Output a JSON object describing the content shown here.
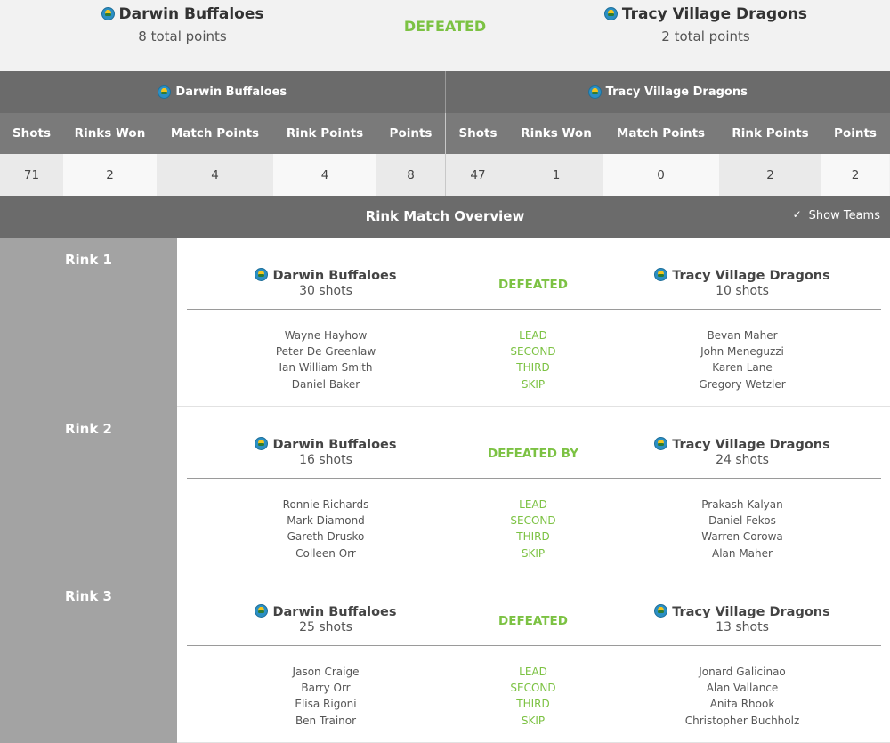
{
  "header": {
    "home_team": "Darwin Buffaloes",
    "home_points": "8 total points",
    "result": "DEFEATED",
    "away_team": "Tracy Village Dragons",
    "away_points": "2 total points"
  },
  "summary": {
    "home_team": "Darwin Buffaloes",
    "away_team": "Tracy Village Dragons",
    "columns": [
      "Shots",
      "Rinks Won",
      "Match Points",
      "Rink Points",
      "Points"
    ],
    "home_values": [
      "71",
      "2",
      "4",
      "4",
      "8"
    ],
    "away_values": [
      "47",
      "1",
      "0",
      "2",
      "2"
    ]
  },
  "overview": {
    "title": "Rink Match Overview",
    "show_teams_label": "Show Teams",
    "show_teams_checked": true
  },
  "positions": [
    "LEAD",
    "SECOND",
    "THIRD",
    "SKIP"
  ],
  "rinks": [
    {
      "label": "Rink 1",
      "home_team": "Darwin Buffaloes",
      "home_shots": "30 shots",
      "result": "DEFEATED",
      "away_team": "Tracy Village Dragons",
      "away_shots": "10 shots",
      "home_players": [
        "Wayne Hayhow",
        "Peter De Greenlaw",
        "Ian William Smith",
        "Daniel Baker"
      ],
      "away_players": [
        "Bevan Maher",
        "John Meneguzzi",
        "Karen Lane",
        "Gregory Wetzler"
      ]
    },
    {
      "label": "Rink 2",
      "home_team": "Darwin Buffaloes",
      "home_shots": "16 shots",
      "result": "DEFEATED BY",
      "away_team": "Tracy Village Dragons",
      "away_shots": "24 shots",
      "home_players": [
        "Ronnie Richards",
        "Mark Diamond",
        "Gareth Drusko",
        "Colleen Orr"
      ],
      "away_players": [
        "Prakash Kalyan",
        "Daniel Fekos",
        "Warren Corowa",
        "Alan Maher"
      ]
    },
    {
      "label": "Rink 3",
      "home_team": "Darwin Buffaloes",
      "home_shots": "25 shots",
      "result": "DEFEATED",
      "away_team": "Tracy Village Dragons",
      "away_shots": "13 shots",
      "home_players": [
        "Jason Craige",
        "Barry Orr",
        "Elisa Rigoni",
        "Ben Trainor"
      ],
      "away_players": [
        "Jonard Galicinao",
        "Alan Vallance",
        "Anita Rhook",
        "Christopher Buchholz"
      ]
    }
  ],
  "colors": {
    "accent": "#7cc243",
    "header_bar": "#6b6b6b",
    "rink_label_bg": "#a3a3a3"
  },
  "icons": {
    "team_logo": "team-logo-icon",
    "checkbox": "checkbox-icon"
  }
}
